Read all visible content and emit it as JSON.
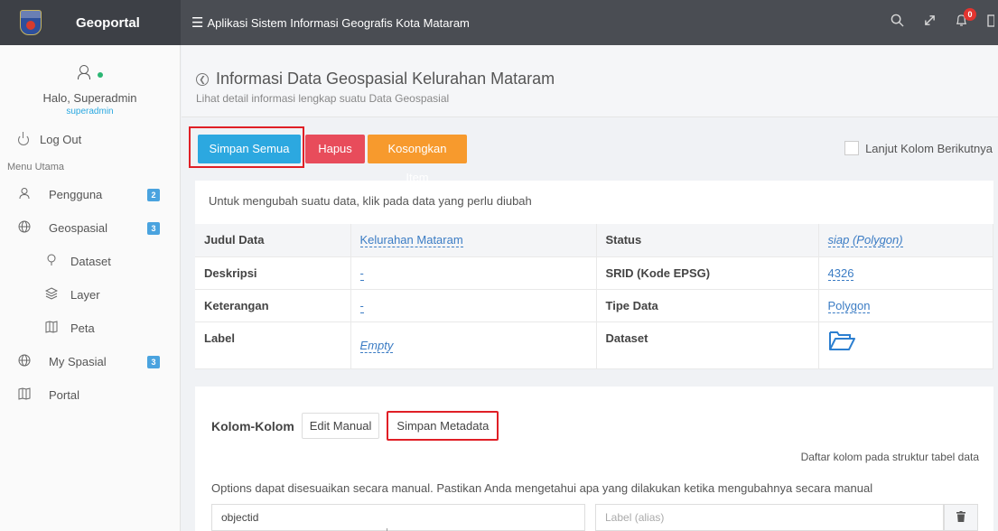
{
  "topbar": {
    "brand": "Geoportal",
    "app_title": "Aplikasi Sistem Informasi Geografis Kota Mataram",
    "notif_count": "0",
    "icons": [
      "search-icon",
      "expand-icon",
      "bell-icon",
      "panel-icon"
    ]
  },
  "sidebar": {
    "greeting": "Halo, Superadmin",
    "username": "superadmin",
    "logout": "Log Out",
    "menu_head": "Menu Utama",
    "items": [
      {
        "label": "Pengguna",
        "badge": "2",
        "icon": "users-icon"
      },
      {
        "label": "Geospasial",
        "badge": "3",
        "icon": "globe-icon"
      },
      {
        "label": "Dataset",
        "icon": "pin-icon"
      },
      {
        "label": "Layer",
        "icon": "layers-icon"
      },
      {
        "label": "Peta",
        "icon": "map-icon"
      },
      {
        "label": "My Spasial",
        "badge": "3",
        "icon": "globe-icon"
      },
      {
        "label": "Portal",
        "icon": "map-icon"
      }
    ]
  },
  "page": {
    "title": "Informasi Data Geospasial Kelurahan Mataram",
    "subtitle": "Lihat detail informasi lengkap suatu Data Geospasial"
  },
  "toolbar": {
    "save_all": "Simpan Semua",
    "delete": "Hapus",
    "clear": "Kosongkan Item",
    "next_col": "Lanjut Kolom Berikutnya"
  },
  "info": {
    "note": "Untuk mengubah suatu data, klik pada data yang perlu diubah",
    "rows": [
      {
        "l1": "Judul Data",
        "v1": "Kelurahan Mataram",
        "l2": "Status",
        "v2": "siap (Polygon)"
      },
      {
        "l1": "Deskripsi",
        "v1": "-",
        "l2": "SRID (Kode EPSG)",
        "v2": "4326"
      },
      {
        "l1": "Keterangan",
        "v1": "-",
        "l2": "Tipe Data",
        "v2": "Polygon"
      },
      {
        "l1": "Label",
        "v1": "Empty",
        "l2": "Dataset",
        "v2": ""
      }
    ]
  },
  "kolom": {
    "title": "Kolom-Kolom",
    "edit_manual": "Edit Manual",
    "save_metadata": "Simpan Metadata",
    "right_note": "Daftar kolom pada struktur tabel data",
    "options_note": "Options dapat disesuaikan secara manual. Pastikan Anda mengetahui apa yang dilakukan ketika mengubahnya secara manual",
    "field_value": "objectid",
    "alias_placeholder": "Label (alias)"
  },
  "colors": {
    "accent": "#2ca8e0",
    "danger": "#e84c5b",
    "warning": "#f79a2d",
    "highlight": "#e01f26"
  }
}
